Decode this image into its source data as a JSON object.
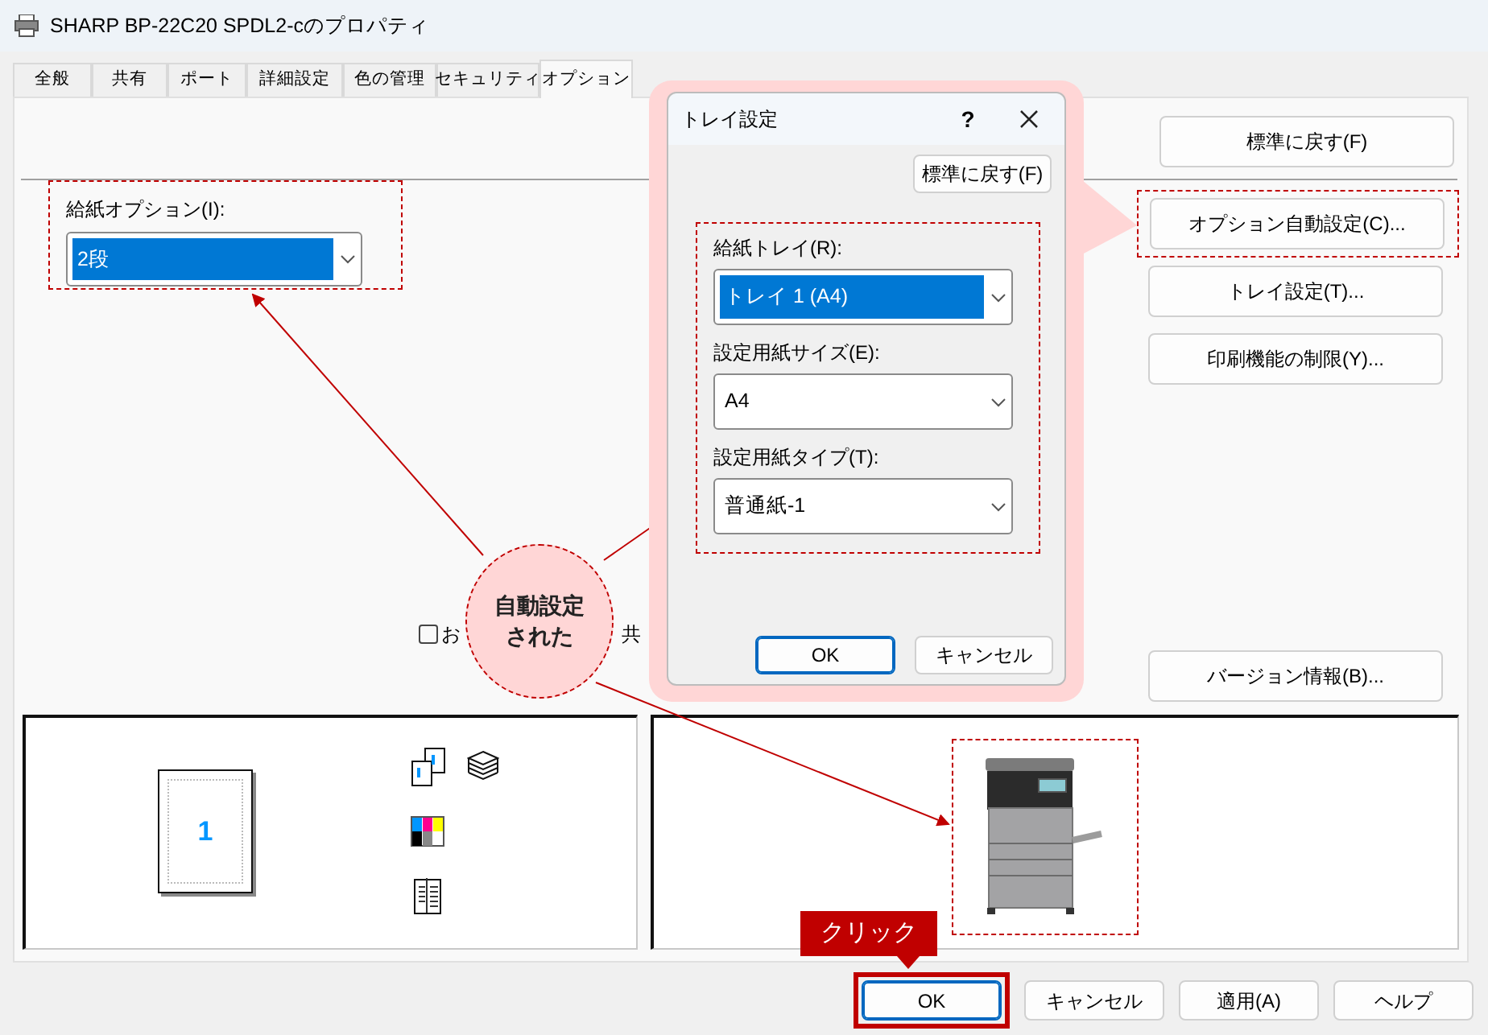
{
  "window": {
    "title": "SHARP BP-22C20 SPDL2-cのプロパティ"
  },
  "tabs": [
    {
      "label": "全般",
      "selected": false
    },
    {
      "label": "共有",
      "selected": false
    },
    {
      "label": "ポート",
      "selected": false
    },
    {
      "label": "詳細設定",
      "selected": false
    },
    {
      "label": "色の管理",
      "selected": false
    },
    {
      "label": "セキュリティ",
      "selected": false
    },
    {
      "label": "オプション",
      "selected": true
    }
  ],
  "options": {
    "feed_option": {
      "label": "給紙オプション(I):",
      "value": "2段",
      "focused": true
    },
    "reset_button": "標準に戻す(F)",
    "auto_button": "オプション自動設定(C)...",
    "tray_button": "トレイ設定(T)...",
    "restrict_button": "印刷機能の制限(Y)...",
    "version_button": "バージョン情報(B)...",
    "checkbox": {
      "label_parts": [
        "お",
        "共"
      ],
      "checked": false
    },
    "preview": {
      "page_number": "1"
    }
  },
  "dialog": {
    "title": "トレイ設定",
    "help": "?",
    "reset_button": "標準に戻す(F)",
    "fields": [
      {
        "label": "給紙トレイ(R):",
        "value": "トレイ 1 (A4)",
        "focused": true
      },
      {
        "label": "設定用紙サイズ(E):",
        "value": "A4",
        "focused": false
      },
      {
        "label": "設定用紙タイプ(T):",
        "value": "普通紙-1",
        "focused": false
      }
    ],
    "buttons": [
      {
        "label": "OK",
        "default": true
      },
      {
        "label": "キャンセル",
        "default": false
      }
    ]
  },
  "annotation": {
    "callout": "自動設定された",
    "click_label": "クリック"
  },
  "footer_buttons": [
    {
      "label": "OK",
      "default": true
    },
    {
      "label": "キャンセル",
      "default": false
    },
    {
      "label": "適用(A)",
      "default": false
    },
    {
      "label": "ヘルプ",
      "default": false
    }
  ]
}
